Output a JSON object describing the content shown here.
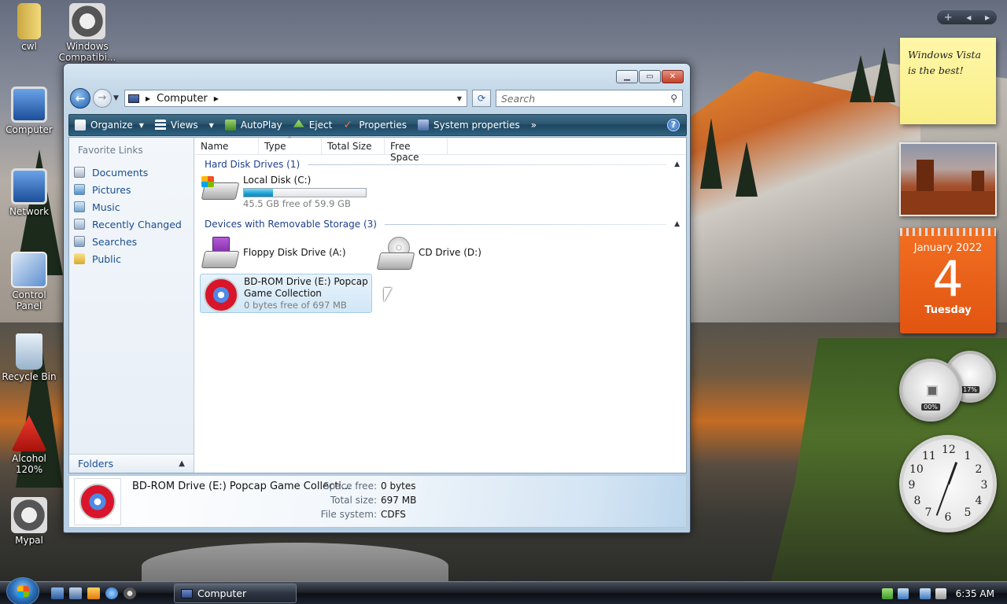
{
  "desktop": {
    "icons": [
      {
        "label": "cwl"
      },
      {
        "label": "Windows Compatibi..."
      },
      {
        "label": "Computer"
      },
      {
        "label": "Network"
      },
      {
        "label": "Control Panel"
      },
      {
        "label": "Recycle Bin"
      },
      {
        "label": "Alcohol 120%"
      },
      {
        "label": "Mypal"
      }
    ]
  },
  "gadgets": {
    "controls": {
      "add": "+",
      "prev": "◀",
      "next": "▶"
    },
    "note_text": "Windows Vista is the best!",
    "calendar": {
      "month_year": "January 2022",
      "day": "4",
      "weekday": "Tuesday"
    },
    "cpu_meter": {
      "cpu": "00%",
      "memory": "17%"
    },
    "clock": {
      "numbers": [
        "12",
        "1",
        "2",
        "3",
        "4",
        "5",
        "6",
        "7",
        "8",
        "9",
        "10",
        "11"
      ]
    }
  },
  "window": {
    "address": {
      "location": "Computer"
    },
    "search_placeholder": "Search",
    "toolbar": {
      "organize": "Organize",
      "views": "Views",
      "autoplay": "AutoPlay",
      "eject": "Eject",
      "properties": "Properties",
      "system_properties": "System properties",
      "more": "»",
      "help": "?"
    },
    "nav_pane": {
      "title": "Favorite Links",
      "links": [
        "Documents",
        "Pictures",
        "Music",
        "Recently Changed",
        "Searches",
        "Public"
      ],
      "folders": "Folders"
    },
    "columns": [
      "Name",
      "Type",
      "Total Size",
      "Free Space"
    ],
    "groups": {
      "hdd": "Hard Disk Drives (1)",
      "removable": "Devices with Removable Storage (3)"
    },
    "drives": {
      "c": {
        "name": "Local Disk (C:)",
        "free": "45.5 GB free of 59.9 GB",
        "used_fraction": 0.24
      },
      "a": {
        "name": "Floppy Disk Drive (A:)"
      },
      "d": {
        "name": "CD Drive (D:)"
      },
      "e": {
        "name_line1": "BD-ROM Drive (E:) Popcap",
        "name_line2": "Game Collection",
        "free": "0 bytes free of 697 MB"
      }
    },
    "details": {
      "name": "BD-ROM Drive (E:) Popcap Game Collecti...",
      "space_free_label": "Space free:",
      "space_free": "0 bytes",
      "total_size_label": "Total size:",
      "total_size": "697 MB",
      "file_system_label": "File system:",
      "file_system": "CDFS"
    }
  },
  "taskbar": {
    "task_label": "Computer",
    "time": "6:35 AM"
  }
}
